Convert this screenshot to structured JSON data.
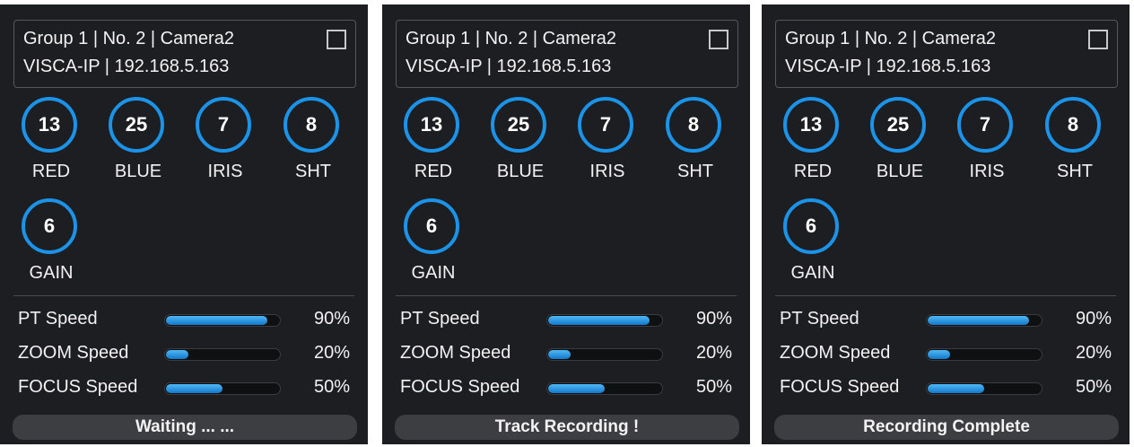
{
  "panels": [
    {
      "info": {
        "line1": "Group 1 | No. 2 | Camera2",
        "line2": "VISCA-IP | 192.168.5.163",
        "checked": false
      },
      "knobs": [
        {
          "value": "13",
          "label": "RED"
        },
        {
          "value": "25",
          "label": "BLUE"
        },
        {
          "value": "7",
          "label": "IRIS"
        },
        {
          "value": "8",
          "label": "SHT"
        },
        {
          "value": "6",
          "label": "GAIN"
        }
      ],
      "speeds": [
        {
          "label": "PT Speed",
          "percent": 90,
          "display": "90%"
        },
        {
          "label": "ZOOM Speed",
          "percent": 20,
          "display": "20%"
        },
        {
          "label": "FOCUS Speed",
          "percent": 50,
          "display": "50%"
        }
      ],
      "status": "Waiting ... ..."
    },
    {
      "info": {
        "line1": "Group 1 | No. 2 | Camera2",
        "line2": "VISCA-IP | 192.168.5.163",
        "checked": false
      },
      "knobs": [
        {
          "value": "13",
          "label": "RED"
        },
        {
          "value": "25",
          "label": "BLUE"
        },
        {
          "value": "7",
          "label": "IRIS"
        },
        {
          "value": "8",
          "label": "SHT"
        },
        {
          "value": "6",
          "label": "GAIN"
        }
      ],
      "speeds": [
        {
          "label": "PT Speed",
          "percent": 90,
          "display": "90%"
        },
        {
          "label": "ZOOM Speed",
          "percent": 20,
          "display": "20%"
        },
        {
          "label": "FOCUS Speed",
          "percent": 50,
          "display": "50%"
        }
      ],
      "status": "Track Recording !"
    },
    {
      "info": {
        "line1": "Group 1 | No. 2 | Camera2",
        "line2": "VISCA-IP | 192.168.5.163",
        "checked": false
      },
      "knobs": [
        {
          "value": "13",
          "label": "RED"
        },
        {
          "value": "25",
          "label": "BLUE"
        },
        {
          "value": "7",
          "label": "IRIS"
        },
        {
          "value": "8",
          "label": "SHT"
        },
        {
          "value": "6",
          "label": "GAIN"
        }
      ],
      "speeds": [
        {
          "label": "PT Speed",
          "percent": 90,
          "display": "90%"
        },
        {
          "label": "ZOOM Speed",
          "percent": 20,
          "display": "20%"
        },
        {
          "label": "FOCUS Speed",
          "percent": 50,
          "display": "50%"
        }
      ],
      "status": "Recording Complete"
    }
  ],
  "colors": {
    "panel_bg": "#1d1e21",
    "accent_ring": "#1b93e8",
    "bar_fill": "#1b93e8",
    "status_bg": "#3d3e42",
    "text": "#f2f2f2"
  }
}
